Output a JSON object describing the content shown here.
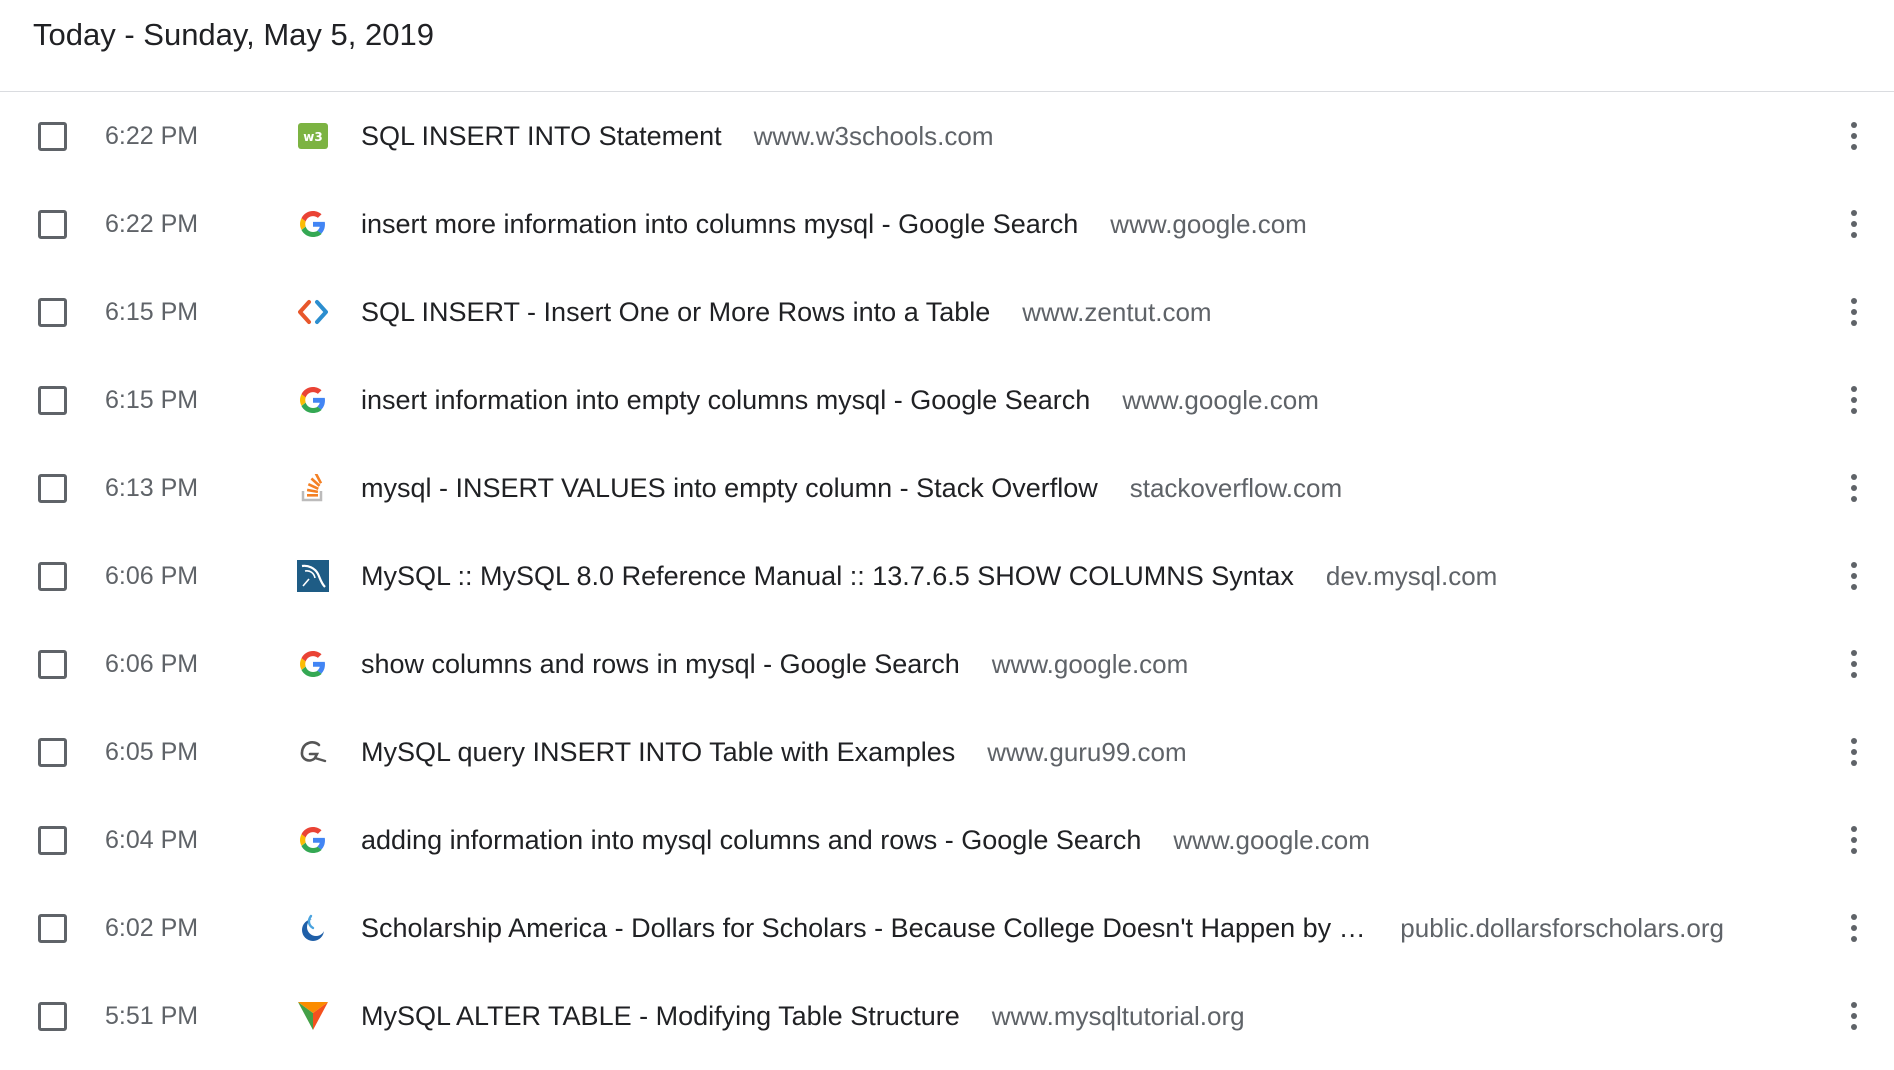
{
  "header": {
    "title": "Today - Sunday, May 5, 2019"
  },
  "colors": {
    "text_primary": "#202124",
    "text_secondary": "#5f6368",
    "divider": "#dadce0"
  },
  "entries": [
    {
      "time": "6:22 PM",
      "title": "SQL INSERT INTO Statement",
      "domain": "www.w3schools.com",
      "icon": "w3schools-icon"
    },
    {
      "time": "6:22 PM",
      "title": "insert more information into columns mysql - Google Search",
      "domain": "www.google.com",
      "icon": "google-icon"
    },
    {
      "time": "6:15 PM",
      "title": "SQL INSERT - Insert One or More Rows into a Table",
      "domain": "www.zentut.com",
      "icon": "zentut-icon"
    },
    {
      "time": "6:15 PM",
      "title": "insert information into empty columns mysql - Google Search",
      "domain": "www.google.com",
      "icon": "google-icon"
    },
    {
      "time": "6:13 PM",
      "title": "mysql - INSERT VALUES into empty column - Stack Overflow",
      "domain": "stackoverflow.com",
      "icon": "stackoverflow-icon"
    },
    {
      "time": "6:06 PM",
      "title": "MySQL :: MySQL 8.0 Reference Manual :: 13.7.6.5 SHOW COLUMNS Syntax",
      "domain": "dev.mysql.com",
      "icon": "mysql-icon"
    },
    {
      "time": "6:06 PM",
      "title": "show columns and rows in mysql - Google Search",
      "domain": "www.google.com",
      "icon": "google-icon"
    },
    {
      "time": "6:05 PM",
      "title": "MySQL query INSERT INTO Table with Examples",
      "domain": "www.guru99.com",
      "icon": "guru99-icon"
    },
    {
      "time": "6:04 PM",
      "title": "adding information into mysql columns and rows - Google Search",
      "domain": "www.google.com",
      "icon": "google-icon"
    },
    {
      "time": "6:02 PM",
      "title": "Scholarship America - Dollars for Scholars - Because College Doesn't Happen by C…",
      "domain": "public.dollarsforscholars.org",
      "icon": "scholarship-america-icon"
    },
    {
      "time": "5:51 PM",
      "title": "MySQL ALTER TABLE - Modifying Table Structure",
      "domain": "www.mysqltutorial.org",
      "icon": "mysqltutorial-icon"
    }
  ]
}
